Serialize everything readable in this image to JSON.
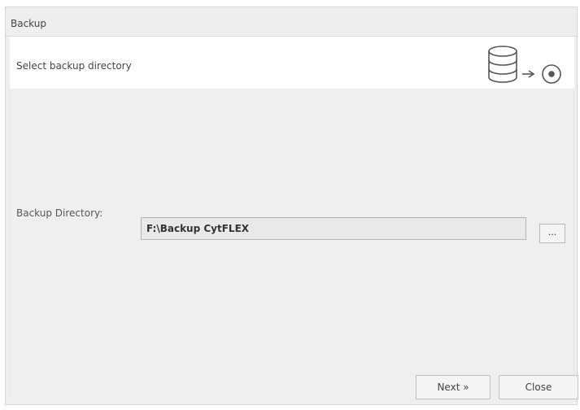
{
  "window": {
    "title": "Backup"
  },
  "header": {
    "text": "Select backup directory",
    "icon": "database-backup-icon"
  },
  "form": {
    "directory_label": "Backup Directory:",
    "directory_value": "F:\\Backup CytFLEX",
    "browse_label": "..."
  },
  "buttons": {
    "next_label": "Next »",
    "close_label": "Close"
  }
}
